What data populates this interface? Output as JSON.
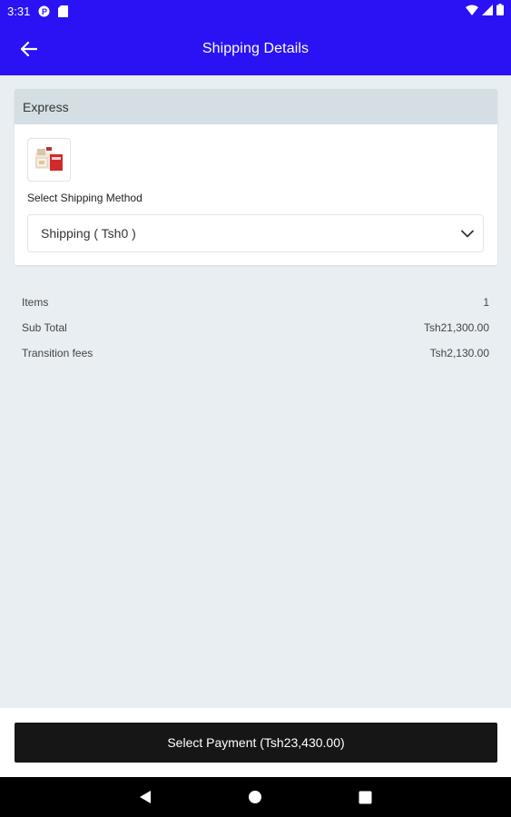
{
  "status_bar": {
    "time": "3:31",
    "left_icons": [
      "p-notification-icon",
      "sd-card-icon"
    ],
    "right_icons": [
      "wifi-icon",
      "cell-signal-icon",
      "battery-icon"
    ]
  },
  "app_bar": {
    "title": "Shipping Details",
    "background": "#2a12f5",
    "back_icon": "arrow-left-icon"
  },
  "shipping_card": {
    "header": "Express",
    "product_image": "product-thumbnail",
    "method_label": "Select Shipping Method",
    "selected_method": "Shipping ( Tsh0 )",
    "dropdown_icon": "chevron-down-icon"
  },
  "summary": {
    "rows": [
      {
        "label": "Items",
        "value": "1"
      },
      {
        "label": "Sub Total",
        "value": "Tsh21,300.00"
      },
      {
        "label": "Transition fees",
        "value": "Tsh2,130.00"
      }
    ]
  },
  "footer": {
    "pay_button_label": "Select Payment (Tsh23,430.00)"
  },
  "nav_bar": {
    "icons": [
      "back-triangle-icon",
      "home-circle-icon",
      "recents-square-icon"
    ]
  }
}
